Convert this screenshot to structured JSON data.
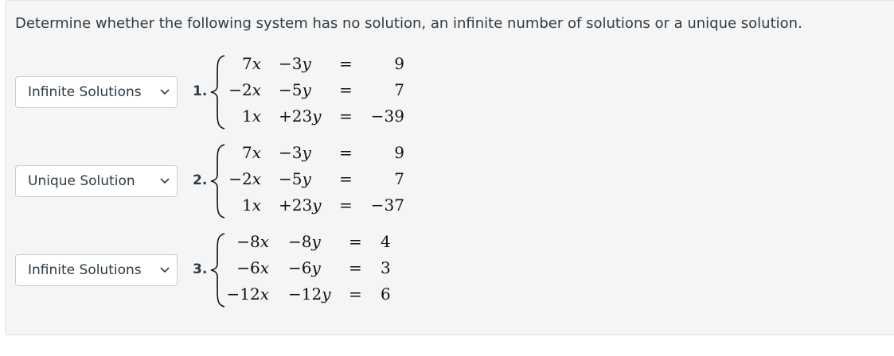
{
  "prompt": "Determine whether the following system has no solution, an infinite number of solutions or a unique solution.",
  "problems": [
    {
      "number": "1.",
      "answer": "Infinite Solutions",
      "rows": [
        {
          "a": "7",
          "b": "−3",
          "rhs": "9"
        },
        {
          "a": "−2",
          "b": "−5",
          "rhs": "7"
        },
        {
          "a": "1",
          "b": "+23",
          "rhs": "−39"
        }
      ]
    },
    {
      "number": "2.",
      "answer": "Unique Solution",
      "rows": [
        {
          "a": "7",
          "b": "−3",
          "rhs": "9"
        },
        {
          "a": "−2",
          "b": "−5",
          "rhs": "7"
        },
        {
          "a": "1",
          "b": "+23",
          "rhs": "−37"
        }
      ]
    },
    {
      "number": "3.",
      "answer": "Infinite Solutions",
      "rows": [
        {
          "a": "−8",
          "b": "−8",
          "rhs": "4"
        },
        {
          "a": "−6",
          "b": "−6",
          "rhs": "3"
        },
        {
          "a": "−12",
          "b": "−12",
          "rhs": "6"
        }
      ]
    }
  ],
  "x_var": "x",
  "y_var": "y",
  "equals": "="
}
